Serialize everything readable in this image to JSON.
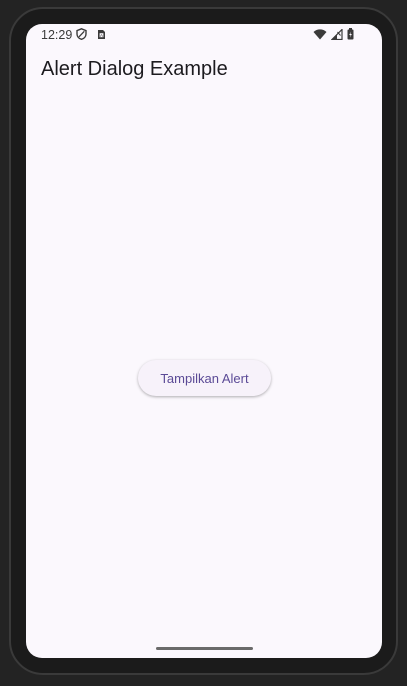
{
  "status_bar": {
    "time": "12:29",
    "icons_left": [
      "shield-icon",
      "sim-card-icon"
    ],
    "icons_right": [
      "wifi-icon",
      "signal-icon",
      "battery-icon"
    ]
  },
  "app_bar": {
    "title": "Alert Dialog Example"
  },
  "main": {
    "button_label": "Tampilkan Alert"
  },
  "colors": {
    "background": "#fbf8fd",
    "button_text": "#5b4a96",
    "button_bg": "#f7f2fa",
    "frame": "#1b1b1b"
  }
}
